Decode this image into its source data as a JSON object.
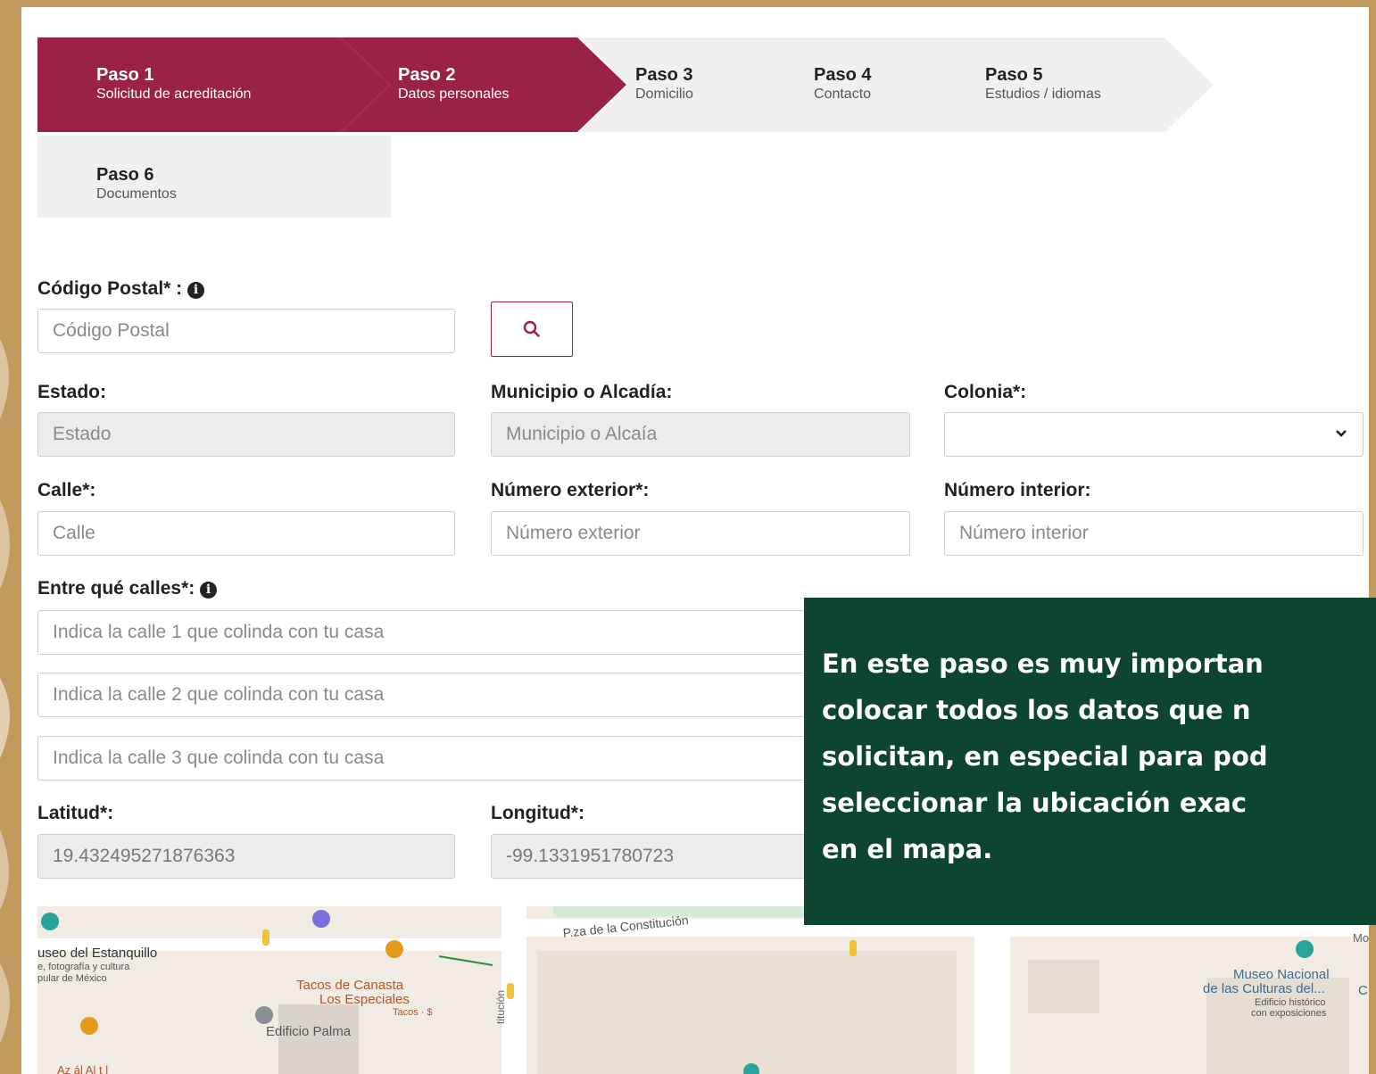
{
  "steps": [
    {
      "title": "Paso 1",
      "subtitle": "Solicitud de acreditación",
      "state": "active"
    },
    {
      "title": "Paso 2",
      "subtitle": "Datos personales",
      "state": "active"
    },
    {
      "title": "Paso 3",
      "subtitle": "Domicilio",
      "state": "inactive"
    },
    {
      "title": "Paso 4",
      "subtitle": "Contacto",
      "state": "inactive"
    },
    {
      "title": "Paso 5",
      "subtitle": "Estudios / idiomas",
      "state": "inactive"
    },
    {
      "title": "Paso 6",
      "subtitle": "Documentos",
      "state": "inactive"
    }
  ],
  "form": {
    "cp_label": "Código Postal* :",
    "cp_placeholder": "Código Postal",
    "estado_label": "Estado:",
    "estado_placeholder": "Estado",
    "municipio_label": "Municipio o Alcadía:",
    "municipio_placeholder": "Municipio o Alcaía",
    "colonia_label": "Colonia*:",
    "calle_label": "Calle*:",
    "calle_placeholder": "Calle",
    "num_ext_label": "Número exterior*:",
    "num_ext_placeholder": "Número exterior",
    "num_int_label": "Número interior:",
    "num_int_placeholder": "Número interior",
    "entre_label": "Entre qué calles*:",
    "calle1_placeholder": "Indica la calle 1 que colinda con tu casa",
    "calle2_placeholder": "Indica la calle 2 que colinda con tu casa",
    "calle3_placeholder": "Indica la calle 3 que colinda con tu casa",
    "lat_label": "Latitud*:",
    "lat_value": "19.432495271876363",
    "lng_label": "Longitud*:",
    "lng_value": "-99.1331951780723"
  },
  "map": {
    "museo_estanquillo": "useo del Estanquillo",
    "museo_estanquillo_sub1": "e, fotografía y cultura",
    "museo_estanquillo_sub2": "pular de México",
    "tacos1": "Tacos de Canasta",
    "tacos2": "Los Especiales",
    "tacos_sub": "Tacos · $",
    "edificio_palma": "Edificio Palma",
    "plaza": "P.za de la Constitución",
    "constitucion_v": "titución",
    "museo_nac1": "Museo Nacional",
    "museo_nac2": "de las Culturas del...",
    "museo_nac_sub1": "Edificio histórico",
    "museo_nac_sub2": "con exposiciones",
    "mon": "Mon",
    "c": "C",
    "bottom_text": "Az  ál Al  t  l   ",
    "colors": {
      "accent": "#9b2247",
      "callout": "#0d4530",
      "frame": "#c29a60"
    }
  },
  "callout": {
    "line1": "En este paso es muy importan",
    "line2": "colocar todos los datos que n",
    "line3": "solicitan, en especial para pod",
    "line4": "seleccionar la ubicación exac",
    "line5": "en el mapa."
  }
}
